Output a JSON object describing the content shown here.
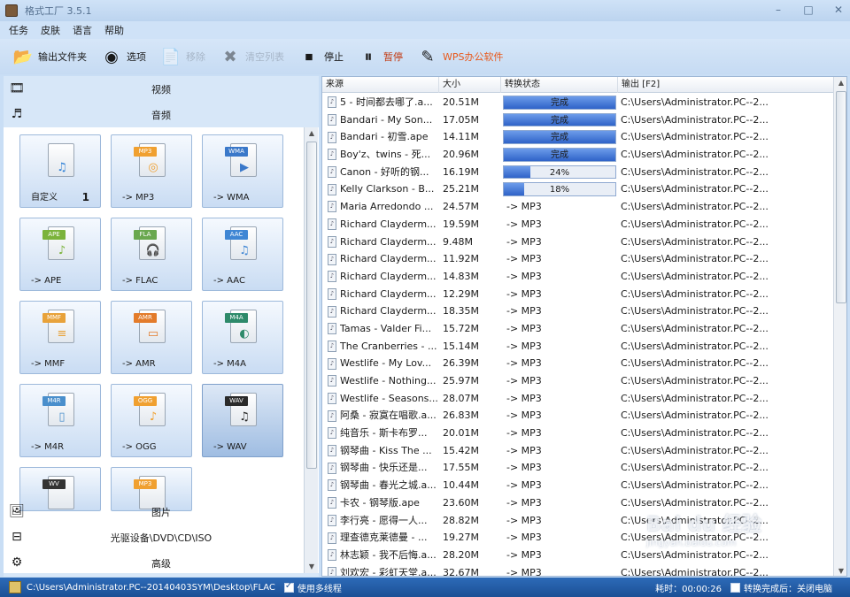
{
  "window": {
    "title": "格式工厂 3.5.1",
    "buttons": [
      "–",
      "□",
      "✕"
    ]
  },
  "menu": [
    "任务",
    "皮肤",
    "语言",
    "帮助"
  ],
  "toolbar": [
    {
      "label": "输出文件夹",
      "icon": "folder-output-icon",
      "glyph": "📂",
      "enabled": true
    },
    {
      "label": "选项",
      "icon": "options-icon",
      "glyph": "◉",
      "enabled": true
    },
    {
      "label": "移除",
      "icon": "remove-icon",
      "glyph": "📄",
      "enabled": false
    },
    {
      "label": "清空列表",
      "icon": "clear-list-icon",
      "glyph": "✖",
      "enabled": false
    },
    {
      "label": "停止",
      "icon": "stop-icon",
      "glyph": "⏹",
      "enabled": true
    },
    {
      "label": "暂停",
      "icon": "pause-icon",
      "glyph": "⏸",
      "enabled": true
    },
    {
      "label": "WPS办公软件",
      "icon": "wps-icon",
      "glyph": "✎",
      "enabled": true
    }
  ],
  "categories_top": [
    {
      "label": "视频",
      "icon": "video-icon"
    },
    {
      "label": "音频",
      "icon": "audio-icon"
    }
  ],
  "categories_bottom": [
    {
      "label": "图片",
      "icon": "picture-icon"
    },
    {
      "label": "光驱设备\\DVD\\CD\\ISO",
      "icon": "optical-drive-icon"
    },
    {
      "label": "高级",
      "icon": "advanced-icon"
    }
  ],
  "audio_formats": [
    {
      "label": "自定义",
      "tag": "",
      "count": "1",
      "color": "#2d7fd6",
      "glyph": "♫"
    },
    {
      "label": "-> MP3",
      "tag": "MP3",
      "color": "#f0a030",
      "glyph": "◎"
    },
    {
      "label": "-> WMA",
      "tag": "WMA",
      "color": "#3a78c9",
      "glyph": "▶"
    },
    {
      "label": "-> APE",
      "tag": "APE",
      "color": "#7bb33b",
      "glyph": "♪"
    },
    {
      "label": "-> FLAC",
      "tag": "FLA",
      "color": "#6aa84f",
      "glyph": "🎧"
    },
    {
      "label": "-> AAC",
      "tag": "AAC",
      "color": "#3f86d4",
      "glyph": "♫"
    },
    {
      "label": "-> MMF",
      "tag": "MMF",
      "color": "#e8a23a",
      "glyph": "≡"
    },
    {
      "label": "-> AMR",
      "tag": "AMR",
      "color": "#e37b2a",
      "glyph": "▭"
    },
    {
      "label": "-> M4A",
      "tag": "M4A",
      "color": "#2e8a6a",
      "glyph": "◐"
    },
    {
      "label": "-> M4R",
      "tag": "M4R",
      "color": "#4a8fcc",
      "glyph": "▯"
    },
    {
      "label": "-> OGG",
      "tag": "OGG",
      "color": "#f0a030",
      "glyph": "♪"
    },
    {
      "label": "-> WAV",
      "tag": "WAV",
      "color": "#2a2a2a",
      "glyph": "♫"
    },
    {
      "label": "",
      "tag": "WV",
      "color": "#333333",
      "glyph": ""
    },
    {
      "label": "",
      "tag": "MP3",
      "color": "#f0a030",
      "glyph": ""
    }
  ],
  "selected_format_index": 11,
  "table": {
    "columns": [
      "来源",
      "大小",
      "转换状态",
      "输出 [F2]"
    ],
    "rows": [
      {
        "source": "5 - 时间都去哪了.a...",
        "size": "20.51M",
        "state": "完成",
        "progress": 1.0,
        "output": "C:\\Users\\Administrator.PC--2..."
      },
      {
        "source": "Bandari - My Son...",
        "size": "17.05M",
        "state": "完成",
        "progress": 1.0,
        "output": "C:\\Users\\Administrator.PC--2..."
      },
      {
        "source": "Bandari - 初雪.ape",
        "size": "14.11M",
        "state": "完成",
        "progress": 1.0,
        "output": "C:\\Users\\Administrator.PC--2..."
      },
      {
        "source": "Boy'z、twins - 死...",
        "size": "20.96M",
        "state": "完成",
        "progress": 1.0,
        "output": "C:\\Users\\Administrator.PC--2..."
      },
      {
        "source": "Canon - 好听的钢...",
        "size": "16.19M",
        "state": "24%",
        "progress": 0.24,
        "output": "C:\\Users\\Administrator.PC--2..."
      },
      {
        "source": "Kelly Clarkson - B...",
        "size": "25.21M",
        "state": "18%",
        "progress": 0.18,
        "output": "C:\\Users\\Administrator.PC--2..."
      },
      {
        "source": "Maria Arredondo ...",
        "size": "24.57M",
        "state": "-> MP3",
        "progress": null,
        "output": "C:\\Users\\Administrator.PC--2..."
      },
      {
        "source": "Richard Clayderm...",
        "size": "19.59M",
        "state": "-> MP3",
        "progress": null,
        "output": "C:\\Users\\Administrator.PC--2..."
      },
      {
        "source": "Richard Clayderm...",
        "size": "9.48M",
        "state": "-> MP3",
        "progress": null,
        "output": "C:\\Users\\Administrator.PC--2..."
      },
      {
        "source": "Richard Clayderm...",
        "size": "11.92M",
        "state": "-> MP3",
        "progress": null,
        "output": "C:\\Users\\Administrator.PC--2..."
      },
      {
        "source": "Richard Clayderm...",
        "size": "14.83M",
        "state": "-> MP3",
        "progress": null,
        "output": "C:\\Users\\Administrator.PC--2..."
      },
      {
        "source": "Richard Clayderm...",
        "size": "12.29M",
        "state": "-> MP3",
        "progress": null,
        "output": "C:\\Users\\Administrator.PC--2..."
      },
      {
        "source": "Richard Clayderm...",
        "size": "18.35M",
        "state": "-> MP3",
        "progress": null,
        "output": "C:\\Users\\Administrator.PC--2..."
      },
      {
        "source": "Tamas - Valder Fi...",
        "size": "15.72M",
        "state": "-> MP3",
        "progress": null,
        "output": "C:\\Users\\Administrator.PC--2..."
      },
      {
        "source": "The Cranberries - ...",
        "size": "15.14M",
        "state": "-> MP3",
        "progress": null,
        "output": "C:\\Users\\Administrator.PC--2..."
      },
      {
        "source": "Westlife - My Lov...",
        "size": "26.39M",
        "state": "-> MP3",
        "progress": null,
        "output": "C:\\Users\\Administrator.PC--2..."
      },
      {
        "source": "Westlife - Nothing...",
        "size": "25.97M",
        "state": "-> MP3",
        "progress": null,
        "output": "C:\\Users\\Administrator.PC--2..."
      },
      {
        "source": "Westlife - Seasons...",
        "size": "28.07M",
        "state": "-> MP3",
        "progress": null,
        "output": "C:\\Users\\Administrator.PC--2..."
      },
      {
        "source": "阿桑 - 寂寞在唱歌.a...",
        "size": "26.83M",
        "state": "-> MP3",
        "progress": null,
        "output": "C:\\Users\\Administrator.PC--2..."
      },
      {
        "source": "纯音乐 - 斯卡布罗...",
        "size": "20.01M",
        "state": "-> MP3",
        "progress": null,
        "output": "C:\\Users\\Administrator.PC--2..."
      },
      {
        "source": "钢琴曲 - Kiss The ...",
        "size": "15.42M",
        "state": "-> MP3",
        "progress": null,
        "output": "C:\\Users\\Administrator.PC--2..."
      },
      {
        "source": "钢琴曲 - 快乐还是...",
        "size": "17.55M",
        "state": "-> MP3",
        "progress": null,
        "output": "C:\\Users\\Administrator.PC--2..."
      },
      {
        "source": "钢琴曲 - 春光之城.a...",
        "size": "10.44M",
        "state": "-> MP3",
        "progress": null,
        "output": "C:\\Users\\Administrator.PC--2..."
      },
      {
        "source": "卡农 - 钢琴版.ape",
        "size": "23.60M",
        "state": "-> MP3",
        "progress": null,
        "output": "C:\\Users\\Administrator.PC--2..."
      },
      {
        "source": "李行亮 - 愿得一人...",
        "size": "28.82M",
        "state": "-> MP3",
        "progress": null,
        "output": "C:\\Users\\Administrator.PC--2..."
      },
      {
        "source": "理查德克莱德曼 - ...",
        "size": "19.27M",
        "state": "-> MP3",
        "progress": null,
        "output": "C:\\Users\\Administrator.PC--2..."
      },
      {
        "source": "林志颖 - 我不后悔.a...",
        "size": "28.20M",
        "state": "-> MP3",
        "progress": null,
        "output": "C:\\Users\\Administrator.PC--2..."
      },
      {
        "source": "刘欢宏 - 彩虹天堂.a...",
        "size": "32.67M",
        "state": "-> MP3",
        "progress": null,
        "output": "C:\\Users\\Administrator.PC--2..."
      }
    ]
  },
  "status": {
    "path": "C:\\Users\\Administrator.PC--20140403SYM\\Desktop\\FLAC",
    "multithread_label": "使用多线程",
    "multithread_checked": true,
    "elapsed": "耗时：00:00:26",
    "after_label": "转换完成后：关闭电脑",
    "after_checked": false
  },
  "watermark": {
    "brand": "Bai du 经验",
    "url": "jingyan.baidu.com"
  },
  "colors": {
    "status_bar": "#1b4f95",
    "progress_fill": "#2f63c8",
    "wps": "#e8581a"
  }
}
